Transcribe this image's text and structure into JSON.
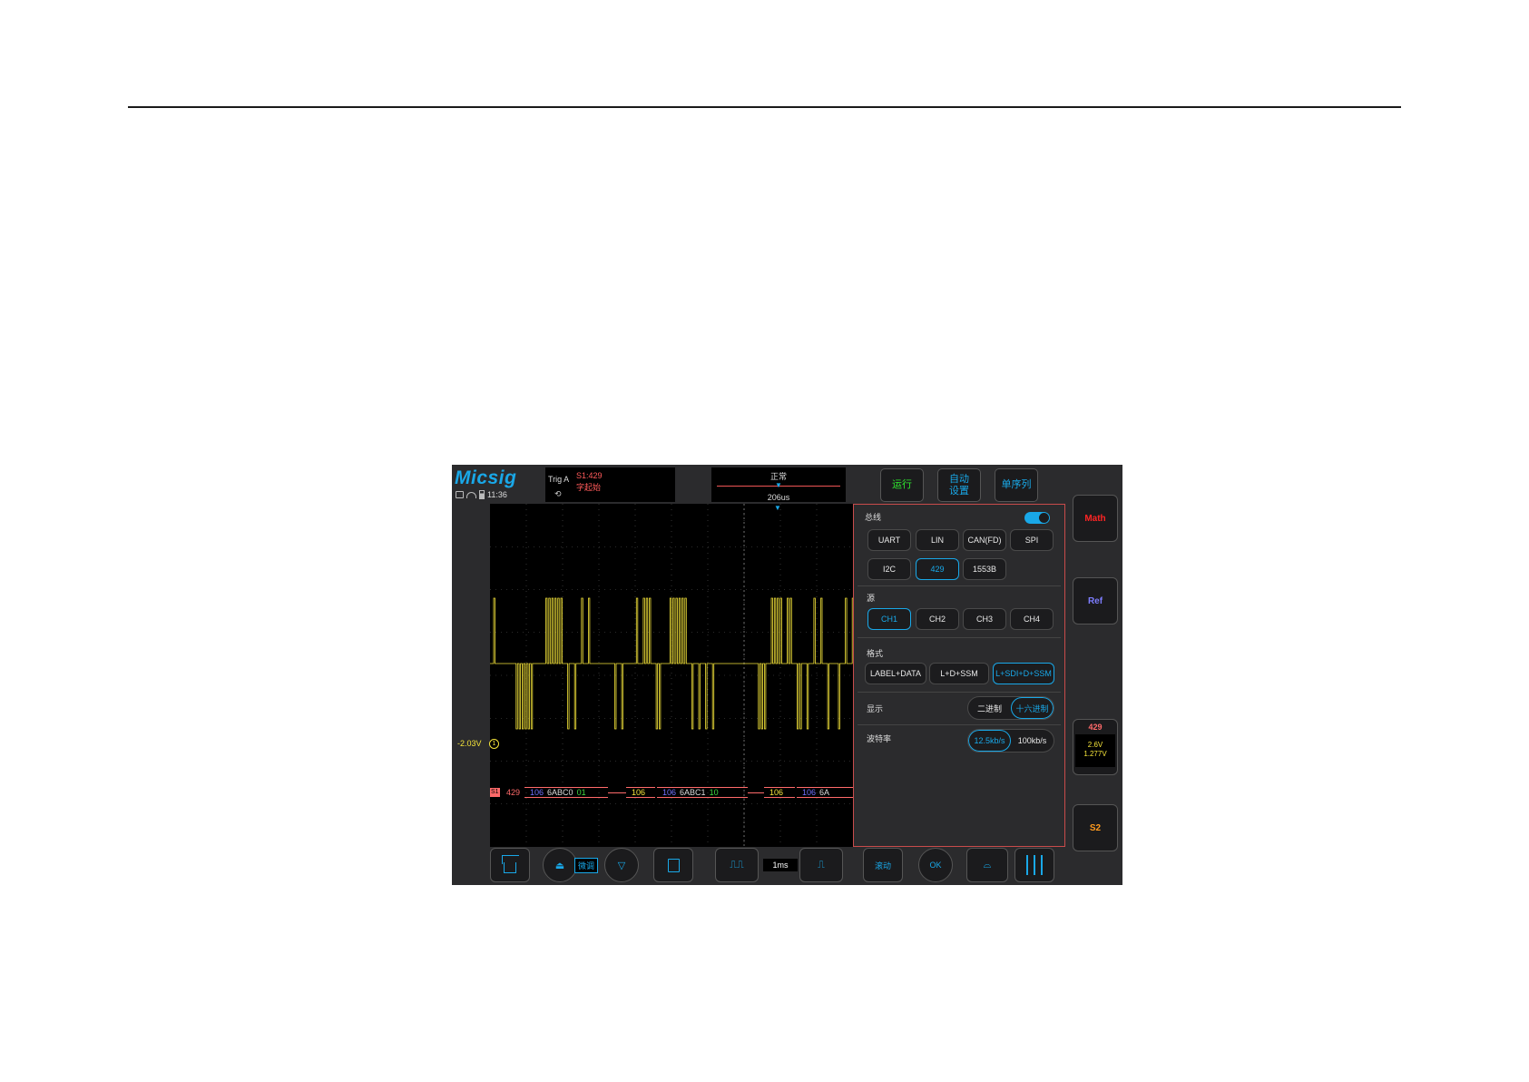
{
  "brand": {
    "logo": "Micsig",
    "time": "11:36"
  },
  "status_icons": [
    "monitor-icon",
    "wifi-icon",
    "battery-icon"
  ],
  "trigger": {
    "label": "Trig  A",
    "source": "S1:429",
    "mode": "字起始",
    "edge_icon": "edge-icon"
  },
  "timebase": {
    "mode": "正常",
    "delay": "206us",
    "value": "1ms"
  },
  "header_buttons": {
    "run": "运行",
    "auto": "自动\n设置",
    "single": "单序列"
  },
  "channel": {
    "offset": "-2.03V",
    "marker": "1"
  },
  "decode": {
    "marker": "S1",
    "protocol": "429",
    "segments": [
      {
        "label": "106",
        "data": "6ABC0",
        "sdi": "01"
      },
      {
        "label": "106",
        "data": "",
        "sdi": "",
        "type": "label"
      },
      {
        "label": "106",
        "data": "6ABC1",
        "sdi": "10"
      },
      {
        "label": "106",
        "data": "",
        "sdi": "",
        "type": "label"
      },
      {
        "label": "106",
        "data": "6A",
        "sdi": ""
      }
    ]
  },
  "bus_menu": {
    "bus_title": "总线",
    "bus_types": [
      "UART",
      "LIN",
      "CAN(FD)",
      "SPI",
      "I2C",
      "429",
      "1553B"
    ],
    "bus_selected": "429",
    "source_title": "源",
    "sources": [
      "CH1",
      "CH2",
      "CH3",
      "CH4"
    ],
    "source_selected": "CH1",
    "format_title": "格式",
    "formats": [
      "LABEL+DATA",
      "L+D+SSM",
      "L+SDI+D+SSM"
    ],
    "format_selected": "L+SDI+D+SSM",
    "display_title": "显示",
    "display_options": [
      "二进制",
      "十六进制"
    ],
    "display_selected": "十六进制",
    "baud_title": "波特率",
    "baud_options": [
      "12.5kb/s",
      "100kb/s"
    ],
    "baud_selected": "12.5kb/s"
  },
  "side": {
    "math": "Math",
    "ref": "Ref",
    "bus_card_title": "429",
    "bus_card_line1": "2.6V",
    "bus_card_line2": "1.277V",
    "s2": "S2"
  },
  "bottom": {
    "fine": "微调",
    "roll": "滚动",
    "auto_meas": "OK"
  },
  "colors": {
    "ch1": "#f5e43a",
    "accent": "#19a8e8",
    "decode": "#ff6a6a",
    "run": "#2ee82e"
  }
}
